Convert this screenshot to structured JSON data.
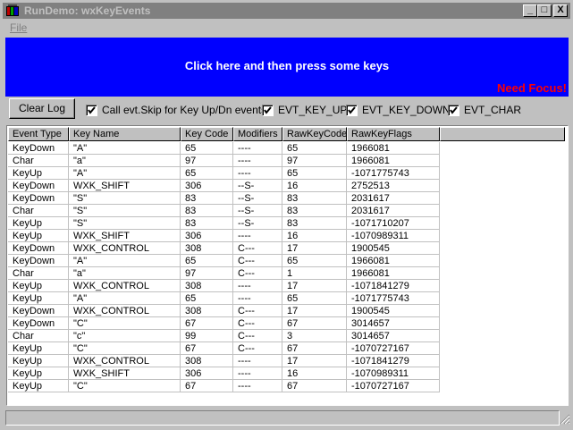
{
  "window": {
    "title": "RunDemo: wxKeyEvents",
    "controls": {
      "minimize": "_",
      "maximize": "□",
      "close": "X"
    }
  },
  "menu": {
    "file": "File"
  },
  "focus_panel": {
    "caption": "Click here and then press some keys",
    "status": "Need Focus!",
    "background": "#0000ff"
  },
  "toolbar": {
    "clear_log": "Clear Log",
    "skip_label": "Call evt.Skip for Key Up/Dn events",
    "skip_checked": true,
    "key_up_label": "EVT_KEY_UP",
    "key_up_checked": true,
    "key_down_label": "EVT_KEY_DOWN",
    "key_down_checked": true,
    "char_label": "EVT_CHAR",
    "char_checked": true
  },
  "log": {
    "columns": [
      "Event Type",
      "Key Name",
      "Key Code",
      "Modifiers",
      "RawKeyCode",
      "RawKeyFlags"
    ],
    "rows": [
      [
        "KeyDown",
        "\"A\"",
        "65",
        "----",
        "65",
        "1966081"
      ],
      [
        "Char",
        "\"a\"",
        "97",
        "----",
        "97",
        "1966081"
      ],
      [
        "KeyUp",
        "\"A\"",
        "65",
        "----",
        "65",
        "-1071775743"
      ],
      [
        "KeyDown",
        "WXK_SHIFT",
        "306",
        "--S-",
        "16",
        "2752513"
      ],
      [
        "KeyDown",
        "\"S\"",
        "83",
        "--S-",
        "83",
        "2031617"
      ],
      [
        "Char",
        "\"S\"",
        "83",
        "--S-",
        "83",
        "2031617"
      ],
      [
        "KeyUp",
        "\"S\"",
        "83",
        "--S-",
        "83",
        "-1071710207"
      ],
      [
        "KeyUp",
        "WXK_SHIFT",
        "306",
        "----",
        "16",
        "-1070989311"
      ],
      [
        "KeyDown",
        "WXK_CONTROL",
        "308",
        "C---",
        "17",
        "1900545"
      ],
      [
        "KeyDown",
        "\"A\"",
        "65",
        "C---",
        "65",
        "1966081"
      ],
      [
        "Char",
        "\"a\"",
        "97",
        "C---",
        "1",
        "1966081"
      ],
      [
        "KeyUp",
        "WXK_CONTROL",
        "308",
        "----",
        "17",
        "-1071841279"
      ],
      [
        "KeyUp",
        "\"A\"",
        "65",
        "----",
        "65",
        "-1071775743"
      ],
      [
        "KeyDown",
        "WXK_CONTROL",
        "308",
        "C---",
        "17",
        "1900545"
      ],
      [
        "KeyDown",
        "\"C\"",
        "67",
        "C---",
        "67",
        "3014657"
      ],
      [
        "Char",
        "\"c\"",
        "99",
        "C---",
        "3",
        "3014657"
      ],
      [
        "KeyUp",
        "\"C\"",
        "67",
        "C---",
        "67",
        "-1070727167"
      ],
      [
        "KeyUp",
        "WXK_CONTROL",
        "308",
        "----",
        "17",
        "-1071841279"
      ],
      [
        "KeyUp",
        "WXK_SHIFT",
        "306",
        "----",
        "16",
        "-1070989311"
      ],
      [
        "KeyUp",
        "\"C\"",
        "67",
        "----",
        "67",
        "-1070727167"
      ]
    ]
  },
  "status_bar": {
    "text": ""
  }
}
